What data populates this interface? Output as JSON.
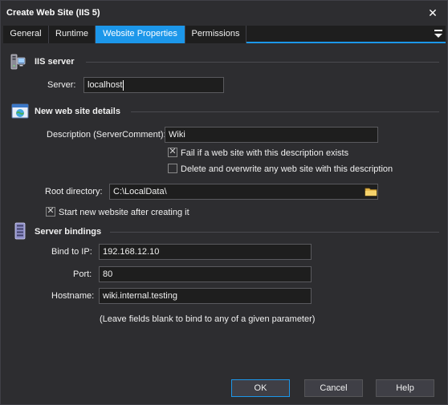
{
  "window": {
    "title": "Create Web Site (IIS 5)",
    "close_glyph": "✕"
  },
  "tabs": [
    {
      "label": "General"
    },
    {
      "label": "Runtime"
    },
    {
      "label": "Website Properties",
      "active": true
    },
    {
      "label": "Permissions"
    }
  ],
  "iis_server": {
    "section_title": "IIS server",
    "server_label": "Server:",
    "server_value": "localhost"
  },
  "site_details": {
    "section_title": "New web site details",
    "description_label": "Description (ServerComment):",
    "description_value": "Wiki",
    "fail_if_exists_label": "Fail if a web site with this description exists",
    "fail_if_exists_checked": true,
    "delete_overwrite_label": "Delete and overwrite any web site with this description",
    "delete_overwrite_checked": false,
    "root_dir_label": "Root directory:",
    "root_dir_value": "C:\\LocalData\\",
    "start_after_label": "Start new website after creating it",
    "start_after_checked": true
  },
  "bindings": {
    "section_title": "Server bindings",
    "ip_label": "Bind to IP:",
    "ip_value": "192.168.12.10",
    "port_label": "Port:",
    "port_value": "80",
    "hostname_label": "Hostname:",
    "hostname_value": "wiki.internal.testing",
    "hint": "(Leave fields blank to bind to any of a given parameter)"
  },
  "buttons": {
    "ok": "OK",
    "cancel": "Cancel",
    "help": "Help"
  },
  "colors": {
    "background": "#2d2d30",
    "accent": "#1c97ea",
    "input_bg": "#1e1e1e"
  },
  "icons": {
    "server_section": "server-computer-icon",
    "site_section": "web-page-icon",
    "bindings_section": "server-rack-icon",
    "browse": "folder-icon",
    "tab_menu": "overflow-menu-icon"
  }
}
